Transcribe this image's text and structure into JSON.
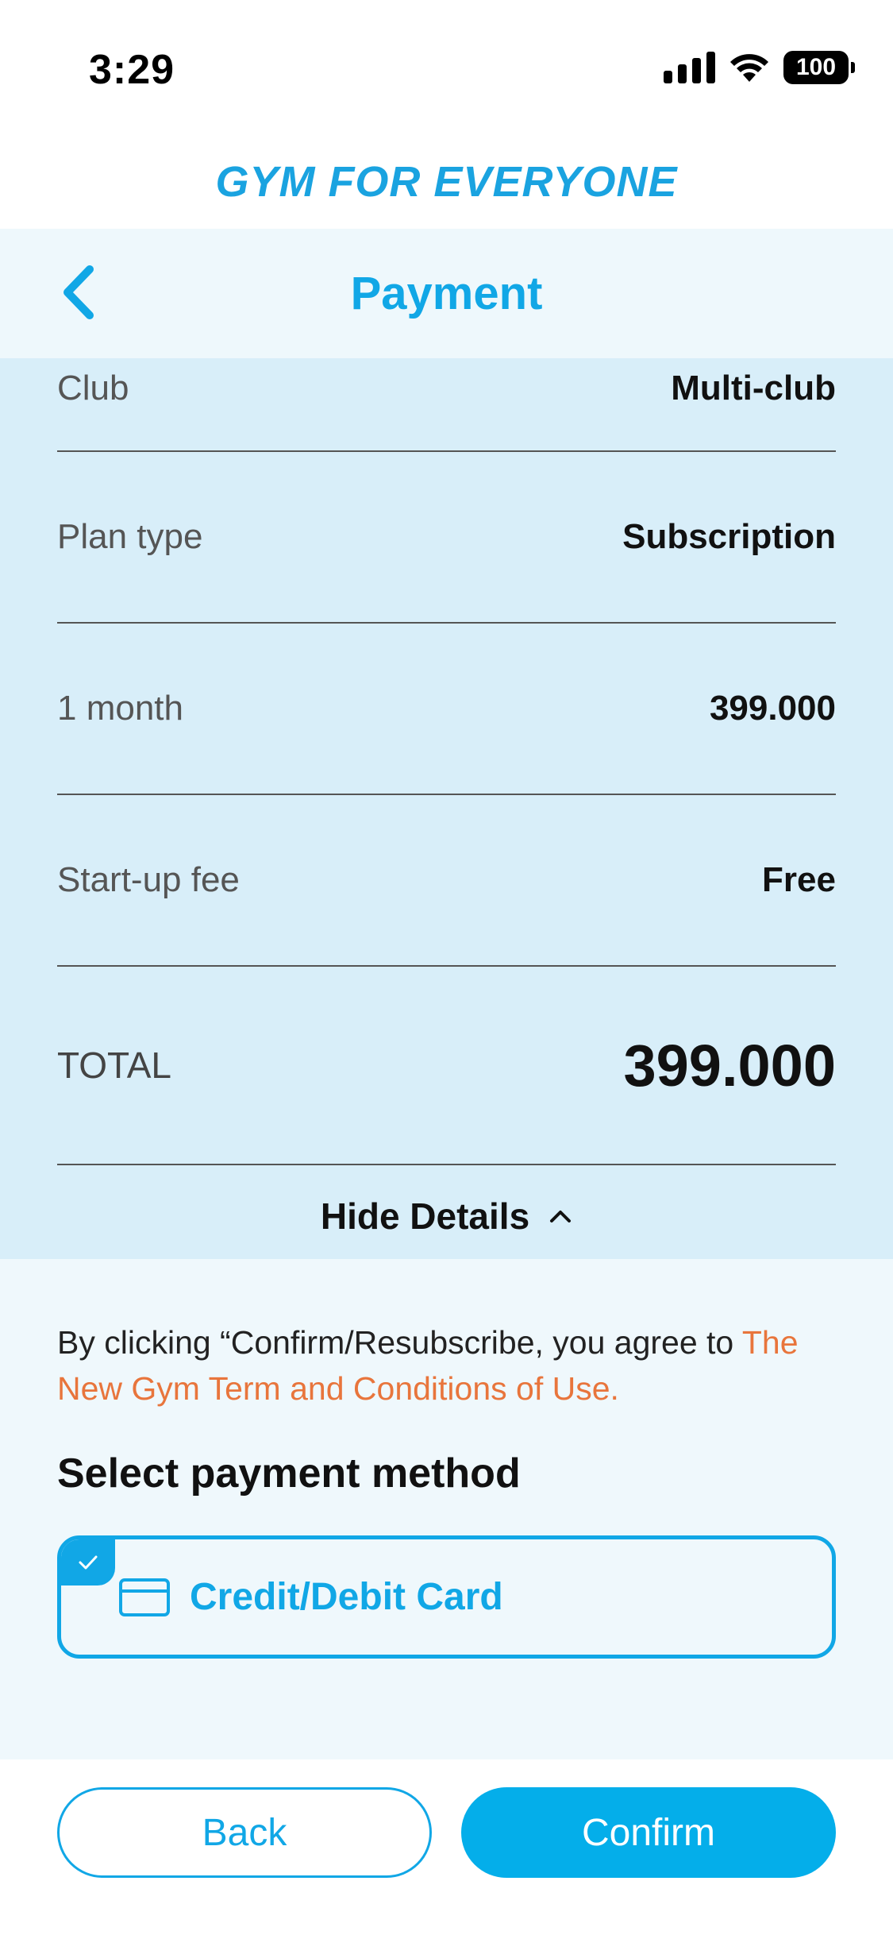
{
  "status_bar": {
    "time": "3:29",
    "battery": "100"
  },
  "brand": {
    "name": "GYM FOR EVERYONE"
  },
  "header": {
    "title": "Payment"
  },
  "details": {
    "rows": [
      {
        "label": "Club",
        "value": "Multi-club"
      },
      {
        "label": "Plan type",
        "value": "Subscription"
      },
      {
        "label": "1 month",
        "value": "399.000"
      },
      {
        "label": "Start-up fee",
        "value": "Free"
      }
    ],
    "total": {
      "label": "TOTAL",
      "value": "399.000"
    },
    "hide_details_label": "Hide Details"
  },
  "terms": {
    "prefix": "By clicking “Confirm/Resubscribe, you agree to ",
    "link": "The New Gym Term and Conditions of Use."
  },
  "payment": {
    "title": "Select payment method",
    "selected_method": "Credit/Debit Card"
  },
  "buttons": {
    "back": "Back",
    "confirm": "Confirm"
  },
  "colors": {
    "accent": "#11a7e6",
    "link": "#e8753c",
    "details_bg": "#d8eef9"
  }
}
